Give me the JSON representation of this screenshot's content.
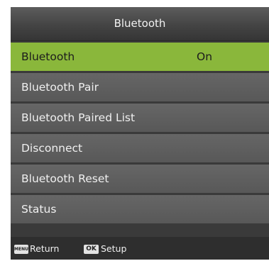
{
  "header": {
    "title": "Bluetooth"
  },
  "menu": {
    "items": [
      {
        "label": "Bluetooth",
        "value": "On",
        "selected": true
      },
      {
        "label": "Bluetooth Pair"
      },
      {
        "label": "Bluetooth Paired List"
      },
      {
        "label": "Disconnect"
      },
      {
        "label": "Bluetooth Reset"
      },
      {
        "label": "Status"
      }
    ]
  },
  "footer": {
    "menu_key": "MENU",
    "return_label": "Return",
    "ok_key": "OK",
    "setup_label": "Setup"
  },
  "colors": {
    "selected": "#8ab73b",
    "item": "#5f5f5f",
    "background": "#3a3a3a"
  }
}
